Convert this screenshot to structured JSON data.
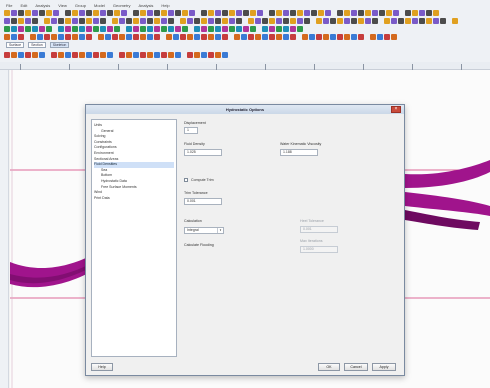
{
  "menu": [
    "File",
    "Edit",
    "Analysis",
    "View",
    "Group",
    "Model",
    "Geometry",
    "Analysis",
    "Help"
  ],
  "selectors": [
    {
      "label": "Surface"
    },
    {
      "label": "Section"
    },
    {
      "label": "Skeleton"
    }
  ],
  "dialog": {
    "title": "Hydrostatic Options",
    "close_glyph": "×",
    "tree": [
      {
        "label": "Units",
        "level": 1
      },
      {
        "label": "General",
        "level": 2
      },
      {
        "label": "Solving",
        "level": 1
      },
      {
        "label": "Constraints",
        "level": 1
      },
      {
        "label": "Configurations",
        "level": 1
      },
      {
        "label": "Environment",
        "level": 1
      },
      {
        "label": "Sectional Areas",
        "level": 1
      },
      {
        "label": "Fluid Densities",
        "level": 1,
        "selected": true
      },
      {
        "label": "Sea",
        "level": 2
      },
      {
        "label": "Bottom",
        "level": 2
      },
      {
        "label": "Hydrostatic Data",
        "level": 2
      },
      {
        "label": "Free Surface Moments",
        "level": 2
      },
      {
        "label": "Wind",
        "level": 1
      },
      {
        "label": "Print Data",
        "level": 1
      }
    ],
    "options": {
      "field_a_label": "Displacement",
      "field_a_value": "1",
      "field_b_label": "Fluid Density",
      "field_b_value": "1.025",
      "field_c_label": "Water Kinematic Viscosity",
      "field_c_value": "1.188",
      "checkbox_label": "Compute Trim",
      "field_d_label": "Trim Tolerance",
      "field_d_value": "0.001",
      "method_label": "Calculation",
      "method_value": "Integral",
      "method_option_label": "Calculate Flooding",
      "dis_a_label": "Heel Tolerance",
      "dis_a_value": "0.001",
      "dis_b_label": "Max Iterations",
      "dis_b_value": "1.0000"
    },
    "buttons": {
      "left": "Help",
      "ok": "OK",
      "cancel": "Cancel",
      "apply": "Apply"
    }
  },
  "colors": {
    "hull": "#a0148c",
    "hull_dark": "#6e0a60",
    "grid_line": "#d33a7a",
    "title_bar": "#d3dfee"
  }
}
